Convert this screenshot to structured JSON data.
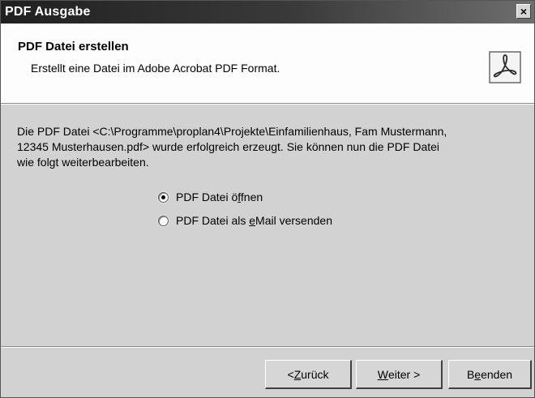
{
  "window": {
    "title": "PDF Ausgabe",
    "close_glyph": "×"
  },
  "header": {
    "title": "PDF Datei erstellen",
    "subtitle": "Erstellt eine Datei im Adobe Acrobat PDF Format.",
    "icon": "pdf-acrobat-icon"
  },
  "message": {
    "line1": "Die PDF Datei <C:\\Programme\\proplan4\\Projekte\\Einfamilienhaus, Fam Mustermann,",
    "line2": "12345 Musterhausen.pdf> wurde erfolgreich erzeugt. Sie können nun die PDF Datei",
    "line3": "wie folgt weiterbearbeiten."
  },
  "options": {
    "open": {
      "label_pre": "PDF Datei ö",
      "label_key": "f",
      "label_post": "fnen",
      "selected": true
    },
    "email": {
      "label_pre": "PDF Datei als ",
      "label_key": "e",
      "label_post": "Mail versenden",
      "selected": false
    }
  },
  "buttons": {
    "back": {
      "pre": "< ",
      "key": "Z",
      "post": "urück"
    },
    "next": {
      "pre": "",
      "key": "W",
      "post": "eiter >"
    },
    "finish": {
      "pre": "B",
      "key": "e",
      "post": "enden"
    }
  },
  "colors": {
    "dialog_bg": "#d2d2d2",
    "header_bg": "#fdfdfd",
    "titlebar": "#202020"
  }
}
